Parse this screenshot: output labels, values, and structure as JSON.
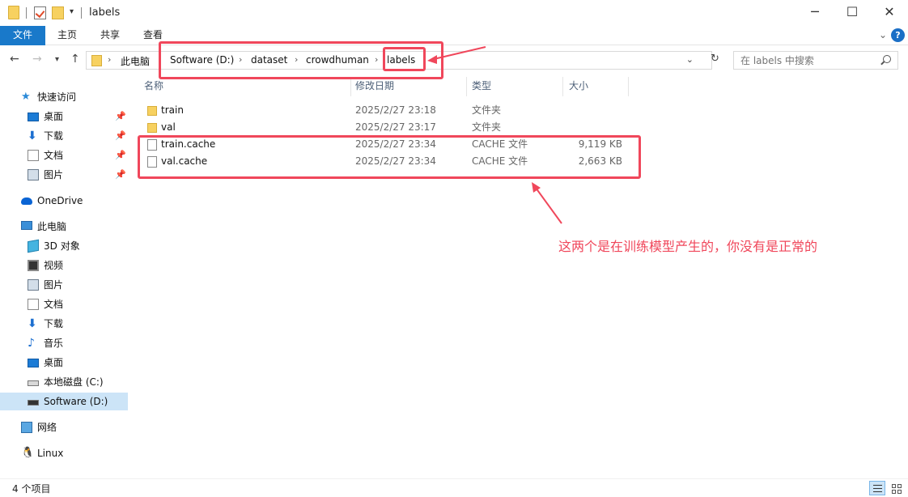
{
  "window": {
    "title": "labels",
    "minimize": "─",
    "maximize": "☐",
    "close": "✕"
  },
  "ribbon": {
    "file_tab": "文件",
    "tabs": [
      "主页",
      "共享",
      "查看"
    ],
    "help": "?"
  },
  "address": {
    "crumbs": [
      "此电脑",
      "Software (D:)",
      "dataset",
      "crowdhuman",
      "labels"
    ],
    "search_placeholder": "在 labels 中搜索"
  },
  "sidebar": {
    "quick_access": "快速访问",
    "quick_items": [
      "桌面",
      "下载",
      "文档",
      "图片"
    ],
    "onedrive": "OneDrive",
    "this_pc": "此电脑",
    "pc_items": [
      "3D 对象",
      "视频",
      "图片",
      "文档",
      "下载",
      "音乐",
      "桌面",
      "本地磁盘 (C:)",
      "Software (D:)"
    ],
    "network": "网络",
    "linux": "Linux"
  },
  "columns": {
    "name": "名称",
    "date": "修改日期",
    "type": "类型",
    "size": "大小"
  },
  "files": [
    {
      "name": "train",
      "date": "2025/2/27 23:18",
      "type": "文件夹",
      "size": "",
      "kind": "folder"
    },
    {
      "name": "val",
      "date": "2025/2/27 23:17",
      "type": "文件夹",
      "size": "",
      "kind": "folder"
    },
    {
      "name": "train.cache",
      "date": "2025/2/27 23:34",
      "type": "CACHE 文件",
      "size": "9,119 KB",
      "kind": "file"
    },
    {
      "name": "val.cache",
      "date": "2025/2/27 23:34",
      "type": "CACHE 文件",
      "size": "2,663 KB",
      "kind": "file"
    }
  ],
  "annotation": {
    "text": "这两个是在训练模型产生的，你没有是正常的",
    "color": "#f0475b"
  },
  "status": {
    "count": "4 个项目"
  }
}
